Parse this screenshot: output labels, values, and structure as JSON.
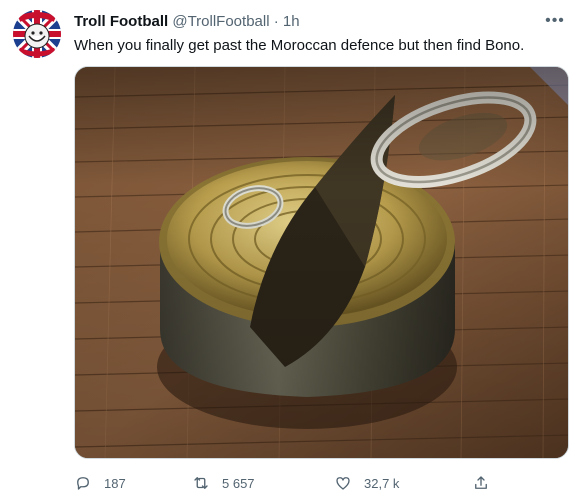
{
  "tweet": {
    "author_name": "Troll Football",
    "author_handle": "@TrollFootball",
    "separator": "·",
    "time": "1h",
    "text": "When you finally get past the Moroccan defence but then find Bono.",
    "avatar_text_top": "SOCCER",
    "avatar_text_bottom": "TROLL FOOTBALL"
  },
  "actions": {
    "reply_count": "187",
    "retweet_count": "5 657",
    "like_count": "32,7 k"
  },
  "colors": {
    "text": "#0f1419",
    "muted": "#536471",
    "border": "#cfd9de"
  },
  "icons": [
    "more-icon",
    "reply-icon",
    "retweet-icon",
    "like-icon",
    "share-icon"
  ]
}
